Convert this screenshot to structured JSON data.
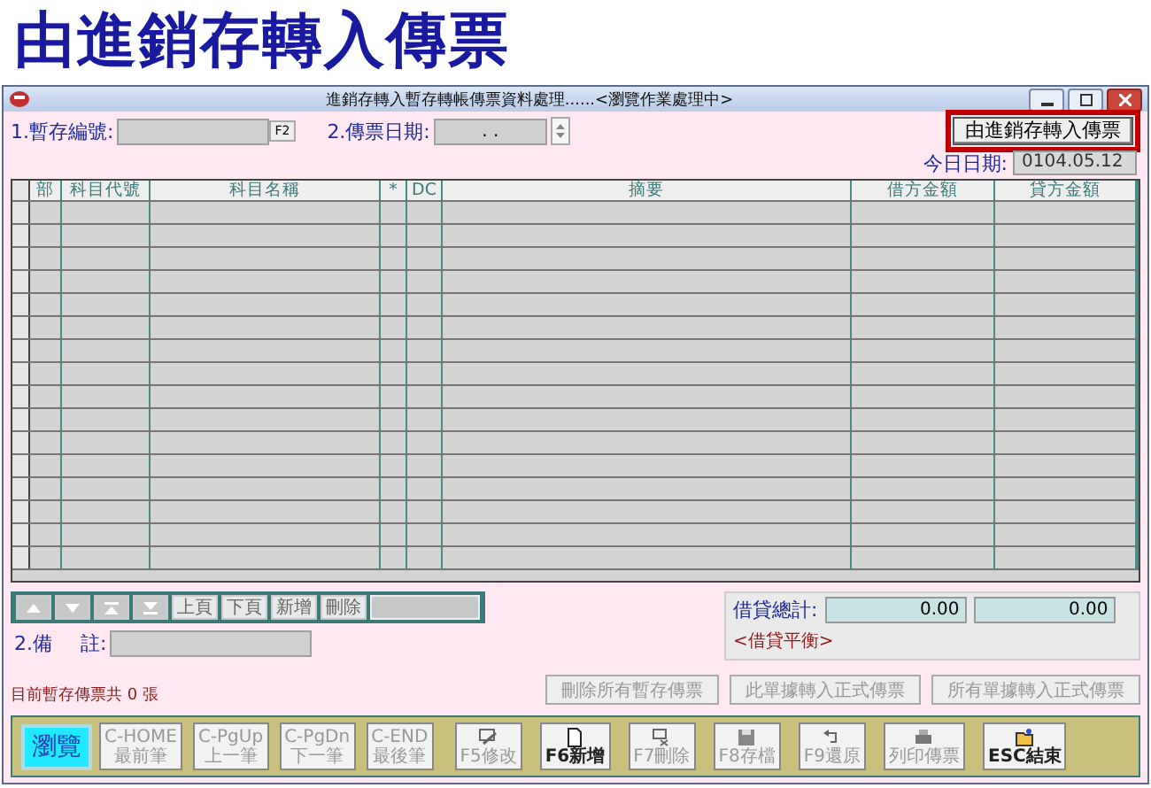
{
  "page_title": "由進銷存轉入傳票",
  "window": {
    "title": "進銷存轉入暫存轉帳傳票資料處理......<瀏覽作業處理中>"
  },
  "form": {
    "voucher_no_label": "1.暫存編號:",
    "voucher_no_key": "F2",
    "date_label": "2.傳票日期:",
    "date_value": ".  .",
    "import_button": {
      "label": "由進銷存轉入傳票",
      "highlighted": true
    },
    "today_label": "今日日期:",
    "today_value": "0104.05.12"
  },
  "table": {
    "columns": [
      "部",
      "科目代號",
      "科目名稱",
      "*",
      "DC",
      "摘要",
      "借方金額",
      "貸方金額"
    ]
  },
  "nav_buttons": [
    {
      "kind": "arrow"
    },
    {
      "kind": "arrow"
    },
    {
      "kind": "arrow"
    },
    {
      "kind": "arrow"
    },
    {
      "label": "上頁",
      "kind": "text"
    },
    {
      "label": "下頁",
      "kind": "text"
    },
    {
      "label": "新增",
      "kind": "text"
    },
    {
      "label": "刪除",
      "kind": "text"
    }
  ],
  "memo": {
    "label_a": "2.備",
    "label_b": "註:"
  },
  "totals": {
    "label": "借貸總計:",
    "debit": "0.00",
    "credit": "0.00",
    "status": "<借貸平衡>"
  },
  "actions": [
    {
      "label": "刪除所有暫存傳票",
      "disabled": true
    },
    {
      "label": "此單據轉入正式傳票",
      "disabled": true
    },
    {
      "label": "所有單據轉入正式傳票",
      "disabled": true
    }
  ],
  "count_text": "目前暫存傳票共 0 張",
  "toolbar": [
    {
      "kind": "mode",
      "lines": [
        "瀏覽"
      ]
    },
    {
      "kind": "key",
      "lines": [
        "C-HOME",
        "最前筆"
      ],
      "disabled": true
    },
    {
      "kind": "key",
      "lines": [
        "C-PgUp",
        "上一筆"
      ],
      "disabled": true
    },
    {
      "kind": "key",
      "lines": [
        "C-PgDn",
        "下一筆"
      ],
      "disabled": true
    },
    {
      "kind": "key",
      "lines": [
        "C-END",
        "最後筆"
      ],
      "disabled": true
    },
    {
      "kind": "icon",
      "lines": [
        "F5修改"
      ],
      "disabled": true
    },
    {
      "kind": "icon",
      "lines": [
        "F6新增"
      ],
      "disabled": false
    },
    {
      "kind": "icon",
      "lines": [
        "F7刪除"
      ],
      "disabled": true
    },
    {
      "kind": "icon",
      "lines": [
        "F8存檔"
      ],
      "disabled": true
    },
    {
      "kind": "icon",
      "lines": [
        "F9還原"
      ],
      "disabled": true
    },
    {
      "kind": "icon",
      "lines": [
        "列印傳票"
      ],
      "disabled": true
    },
    {
      "kind": "icon",
      "lines": [
        "ESC結束"
      ],
      "disabled": false
    }
  ]
}
